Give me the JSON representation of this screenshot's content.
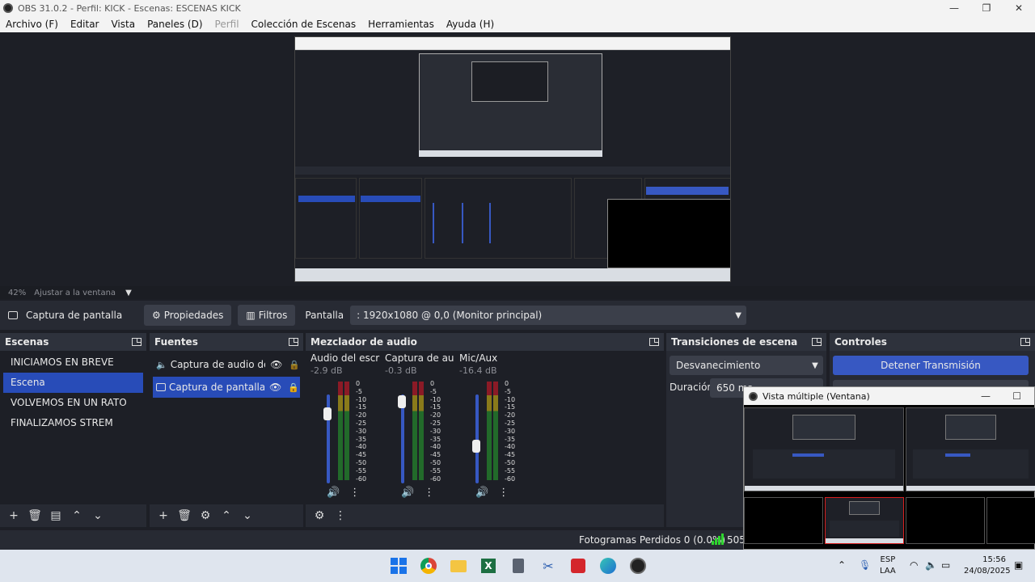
{
  "window": {
    "title": "OBS 31.0.2 - Perfil: KICK - Escenas: ESCENAS KICK",
    "minimize": "—",
    "maximize": "❐",
    "close": "✕"
  },
  "menu": [
    {
      "label": "Archivo (F)",
      "disabled": false
    },
    {
      "label": "Editar",
      "disabled": false
    },
    {
      "label": "Vista",
      "disabled": false
    },
    {
      "label": "Paneles (D)",
      "disabled": false
    },
    {
      "label": "Perfil",
      "disabled": true
    },
    {
      "label": "Colección de Escenas",
      "disabled": false
    },
    {
      "label": "Herramientas",
      "disabled": false
    },
    {
      "label": "Ayuda (H)",
      "disabled": false
    }
  ],
  "zoom": {
    "level": "42%",
    "fit_label": "Ajustar a la ventana",
    "caret": "▼"
  },
  "source_bar": {
    "selected_source": "Captura de pantalla",
    "properties_label": "Propiedades",
    "filters_label": "Filtros",
    "display_label": "Pantalla",
    "display_value": ": 1920x1080 @ 0,0 (Monitor principal)",
    "arrow": "▼"
  },
  "scenes": {
    "title": "Escenas",
    "items": [
      "INICIAMOS EN BREVE",
      "Escena",
      "VOLVEMOS EN UN RATO",
      "FINALIZAMOS STREM"
    ],
    "selected_index": 1,
    "footer": [
      "+",
      "🗑",
      "▤",
      "⌃",
      "⌄"
    ]
  },
  "sources": {
    "title": "Fuentes",
    "items": [
      {
        "label": "Captura de audio de ap",
        "eye": "👁",
        "lock": "🔒"
      },
      {
        "label": "Captura de pantalla",
        "eye": "👁",
        "lock": "🔒"
      }
    ],
    "footer": [
      "+",
      "🗑",
      "⚙",
      "⌃",
      "⌄"
    ]
  },
  "mixer": {
    "title": "Mezclador de audio",
    "channels": [
      {
        "name": "Audio del escrito",
        "db": "-2.9 dB",
        "level": 0.78
      },
      {
        "name": "Captura de audi",
        "db": "-0.3 dB",
        "level": 0.92
      },
      {
        "name": "Mic/Aux",
        "db": "-16.4 dB",
        "level": 0.42
      }
    ],
    "scale": [
      "0",
      "-5",
      "-10",
      "-15",
      "-20",
      "-25",
      "-30",
      "-35",
      "-40",
      "-45",
      "-50",
      "-55",
      "-60"
    ],
    "mute_icon": "🔊",
    "menu_icon": "⋮",
    "footer": [
      "⚙",
      "⋮"
    ]
  },
  "transitions": {
    "title": "Transiciones de escena",
    "selected": "Desvanecimiento",
    "arrow": "▼",
    "duration_label": "Duración",
    "duration_value": "650 ms"
  },
  "controls": {
    "title": "Controles",
    "stop_stream": "Detener Transmisión"
  },
  "status": {
    "frames_dropped": "Fotogramas Perdidos 0 (0.0%)",
    "kbps": "505"
  },
  "multiview": {
    "title": "Vista múltiple (Ventana)",
    "minimize": "—",
    "maximize": "☐"
  },
  "taskbar": {
    "lang_top": "ESP",
    "lang_bottom": "LAA",
    "time": "15:56",
    "date": "24/08/2025"
  },
  "colors": {
    "accent": "#284cb8",
    "button_blue": "#3758c2",
    "panel": "#272a33",
    "background": "#1d1f26"
  }
}
